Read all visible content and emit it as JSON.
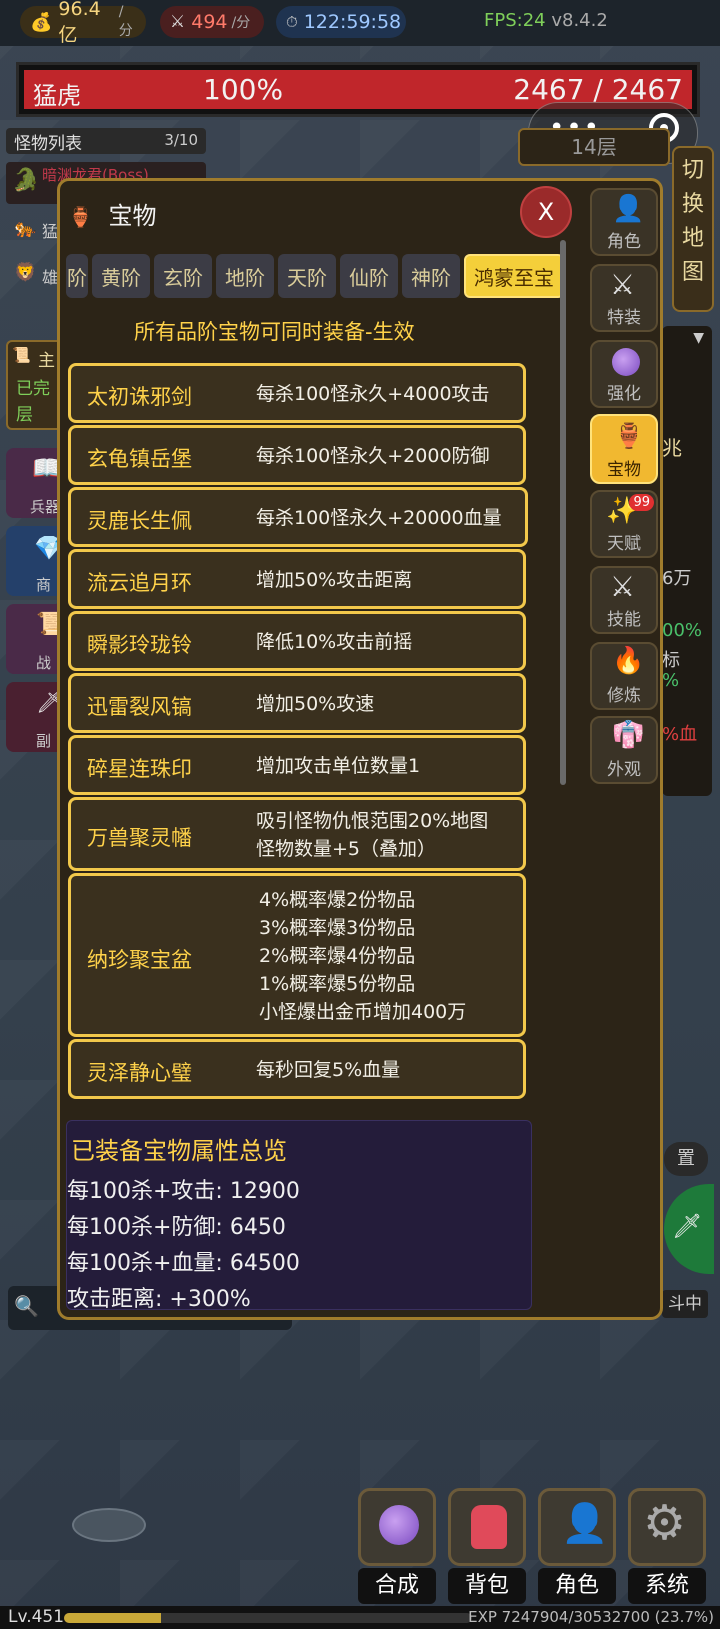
{
  "topbar": {
    "gold": "96.4亿",
    "gold_unit": "/分",
    "kills": "494",
    "kills_unit": "/分",
    "timer": "122:59:58",
    "fps": "FPS:24",
    "version": "v8.4.2"
  },
  "boss_bar": {
    "name": "猛虎",
    "percent": "100%",
    "hp": "2467 / 2467",
    "fill": 1.0
  },
  "floor": "14层",
  "switch_map": [
    "切",
    "换",
    "地",
    "图"
  ],
  "monster_list": {
    "title": "怪物列表",
    "count": "3/10",
    "rows": [
      "暗渊龙君(Boss)",
      "猛",
      "雄"
    ]
  },
  "left_panel": {
    "quest_title": "主",
    "quest_done": "已完",
    "quest_floor": "层",
    "buttons": [
      "兵器",
      "商",
      "战",
      "副"
    ]
  },
  "modal": {
    "title": "宝物",
    "close": "X",
    "tabs": [
      "阶",
      "黄阶",
      "玄阶",
      "地阶",
      "天阶",
      "仙阶",
      "神阶",
      "鸿蒙至宝"
    ],
    "active_tab": 7,
    "subtitle": "所有品阶宝物可同时装备-生效",
    "items": [
      {
        "name": "太初诛邪剑",
        "desc": [
          "每杀100怪永久+4000攻击"
        ]
      },
      {
        "name": "玄龟镇岳堡",
        "desc": [
          "每杀100怪永久+2000防御"
        ]
      },
      {
        "name": "灵鹿长生佩",
        "desc": [
          "每杀100怪永久+20000血量"
        ]
      },
      {
        "name": "流云追月环",
        "desc": [
          "增加50%攻击距离"
        ]
      },
      {
        "name": "瞬影玲珑铃",
        "desc": [
          "降低10%攻击前摇"
        ]
      },
      {
        "name": "迅雷裂风镐",
        "desc": [
          "增加50%攻速"
        ]
      },
      {
        "name": "碎星连珠印",
        "desc": [
          "增加攻击单位数量1"
        ]
      },
      {
        "name": "万兽聚灵幡",
        "desc": [
          "吸引怪物仇恨范围20%地图",
          "怪物数量+5（叠加）"
        ]
      },
      {
        "name": "纳珍聚宝盆",
        "desc": [
          "4%概率爆2份物品",
          "3%概率爆3份物品",
          "2%概率爆4份物品",
          "1%概率爆5份物品",
          "小怪爆出金币增加400万"
        ]
      },
      {
        "name": "灵泽静心璧",
        "desc": [
          "每秒回复5%血量"
        ]
      }
    ],
    "summary": {
      "title": "已装备宝物属性总览",
      "lines": [
        "每100杀+攻击: 12900",
        "每100杀+防御: 6450",
        "每100杀+血量: 64500",
        "攻击距离: +300%"
      ]
    }
  },
  "side_menu": [
    {
      "label": "角色",
      "icon": "person-icon"
    },
    {
      "label": "特装",
      "icon": "crossed-swords-icon"
    },
    {
      "label": "强化",
      "icon": "crystal-ball-icon"
    },
    {
      "label": "宝物",
      "icon": "treasure-jar-icon",
      "active": true
    },
    {
      "label": "天赋",
      "icon": "sparkles-icon",
      "badge": "99"
    },
    {
      "label": "技能",
      "icon": "crossed-swords-icon"
    },
    {
      "label": "修炼",
      "icon": "fire-icon"
    },
    {
      "label": "外观",
      "icon": "robe-icon"
    }
  ],
  "right_panel": {
    "fragments": [
      "兆",
      "6万",
      "00%",
      "标",
      "%",
      "%血",
      "置",
      "斗中"
    ]
  },
  "bottom_nav": [
    "合成",
    "背包",
    "角色",
    "系统"
  ],
  "footer": {
    "level": "Lv.451",
    "exp": "EXP 7247904/30532700 (23.7%)",
    "exp_fraction": 0.237
  },
  "colors": {
    "gold": "#f4cf3a",
    "hp_red": "#c0262b",
    "panel": "#2c2417",
    "border": "#a07c2c"
  }
}
